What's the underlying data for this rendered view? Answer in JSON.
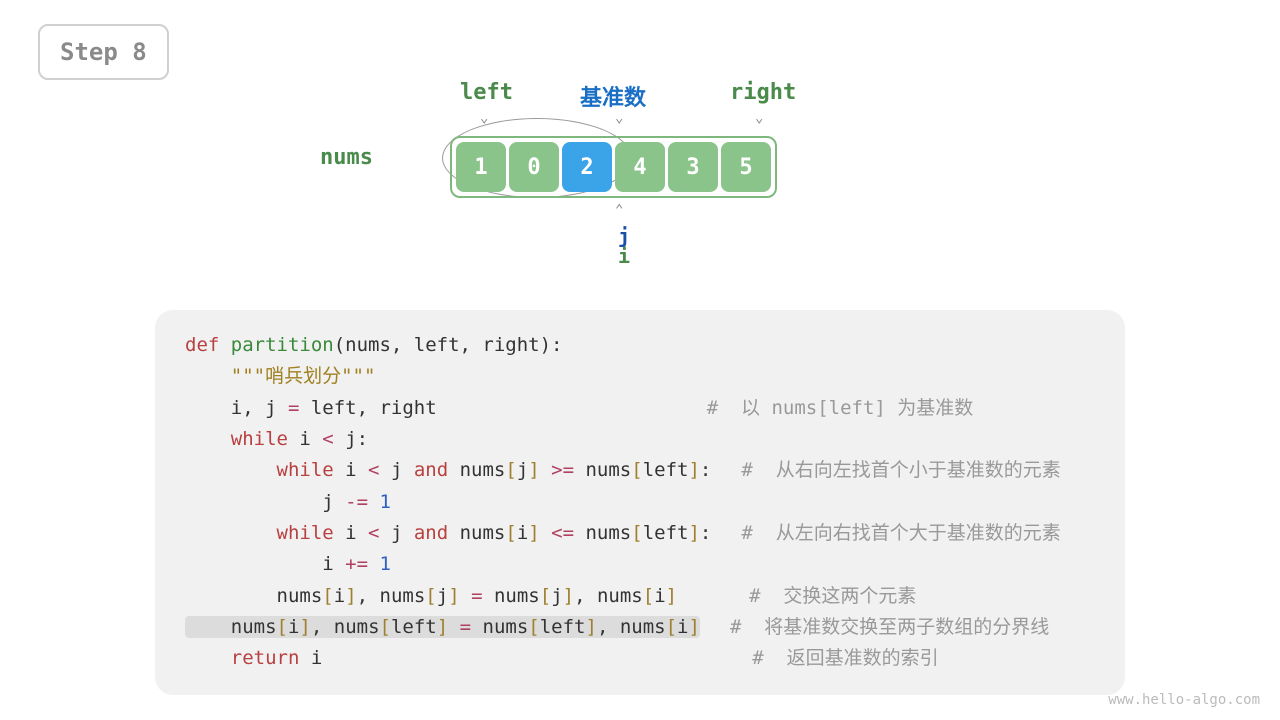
{
  "step_label": "Step 8",
  "labels": {
    "left": "left",
    "pivot": "基准数",
    "right": "right",
    "nums": "nums",
    "j": "j",
    "i": "i"
  },
  "array": [
    "1",
    "0",
    "2",
    "4",
    "3",
    "5"
  ],
  "pivot_index": 2,
  "code": {
    "l0_def": "def ",
    "l0_fn": "partition",
    "l0_rest": "(nums, left, right):",
    "l1": "    \"\"\"哨兵划分\"\"\"",
    "l2_a": "    i, j ",
    "l2_eq": "=",
    "l2_b": " left, right",
    "c2": "#  以 nums[left] 为基准数",
    "l3_a": "    ",
    "l3_w": "while",
    "l3_b": " i ",
    "l3_lt": "<",
    "l3_c": " j:",
    "l4_a": "        ",
    "l4_w": "while",
    "l4_b": " i ",
    "l4_lt": "<",
    "l4_c": " j ",
    "l4_and": "and",
    "l4_d": " nums",
    "l4_br1": "[",
    "l4_e": "j",
    "l4_br2": "]",
    "l4_ge": " >= ",
    "l4_f": "nums",
    "l4_br3": "[",
    "l4_g": "left",
    "l4_br4": "]",
    "l4_h": ":",
    "c4": "#  从右向左找首个小于基准数的元素",
    "l5_a": "            j ",
    "l5_op": "-=",
    "l5_b": " ",
    "l5_n": "1",
    "l6_a": "        ",
    "l6_w": "while",
    "l6_b": " i ",
    "l6_lt": "<",
    "l6_c": " j ",
    "l6_and": "and",
    "l6_d": " nums",
    "l6_br1": "[",
    "l6_e": "i",
    "l6_br2": "]",
    "l6_le": " <= ",
    "l6_f": "nums",
    "l6_br3": "[",
    "l6_g": "left",
    "l6_br4": "]",
    "l6_h": ":",
    "c6": "#  从左向右找首个大于基准数的元素",
    "l7_a": "            i ",
    "l7_op": "+=",
    "l7_b": " ",
    "l7_n": "1",
    "l8_a": "        nums",
    "l8_br1": "[",
    "l8_b": "i",
    "l8_br2": "]",
    "l8_c": ", nums",
    "l8_br3": "[",
    "l8_d": "j",
    "l8_br4": "]",
    "l8_eq": " = ",
    "l8_e": "nums",
    "l8_br5": "[",
    "l8_f": "j",
    "l8_br6": "]",
    "l8_g": ", nums",
    "l8_br7": "[",
    "l8_h": "i",
    "l8_br8": "]",
    "c8": "#  交换这两个元素",
    "l9_a": "    nums",
    "l9_br1": "[",
    "l9_b": "i",
    "l9_br2": "]",
    "l9_c": ", nums",
    "l9_br3": "[",
    "l9_d": "left",
    "l9_br4": "]",
    "l9_eq": " = ",
    "l9_e": "nums",
    "l9_br5": "[",
    "l9_f": "left",
    "l9_br6": "]",
    "l9_g": ", nums",
    "l9_br7": "[",
    "l9_h": "i",
    "l9_br8": "]",
    "c9": "#  将基准数交换至两子数组的分界线",
    "l10_a": "    ",
    "l10_ret": "return",
    "l10_b": " i",
    "c10": "#  返回基准数的索引"
  },
  "footer": "www.hello-algo.com"
}
